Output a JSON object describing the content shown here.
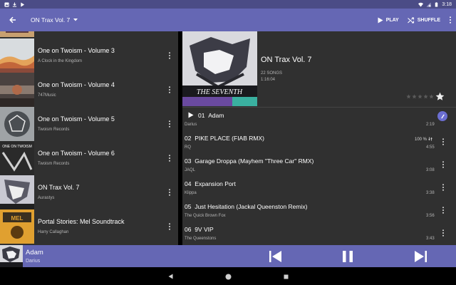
{
  "status_bar": {
    "time": "3:18"
  },
  "toolbar": {
    "title": "ON Trax Vol. 7",
    "play_label": "PLAY",
    "shuffle_label": "SHUFFLE"
  },
  "albums": [
    {
      "title": "One on Twoism - Volume 3",
      "artist": "A Clock in the Kingdom"
    },
    {
      "title": "One on Twoism - Volume 4",
      "artist": "747Music"
    },
    {
      "title": "One on Twoism - Volume 5",
      "artist": "Twoism Records"
    },
    {
      "title": "One on Twoism - Volume 6",
      "artist": "Twoism Records"
    },
    {
      "title": "ON Trax Vol. 7",
      "artist": "Aurastys"
    },
    {
      "title": "Portal Stories: Mel Soundtrack",
      "artist": "Harry Callaghan"
    }
  ],
  "album_art_text": {
    "twoism_6": "ONE ON TWOISM",
    "mel": "MEL"
  },
  "detail": {
    "title": "ON Trax Vol. 7",
    "song_count": "22 SONGS",
    "duration": "1:16:04",
    "cover_text": "THE SEVENTH",
    "rating": 0,
    "rating_max": 5
  },
  "tracks": [
    {
      "number": "01",
      "name": "Adam",
      "artist": "Darius",
      "duration": "2:19",
      "playing": true
    },
    {
      "number": "02",
      "name": "PIKE PLACE (FIAB RMX)",
      "artist": "RQ",
      "duration": "4:55",
      "download": "100 %"
    },
    {
      "number": "03",
      "name": "Garage Droppa (Mayhem \"Three Car\" RMX)",
      "artist": "JAQL",
      "duration": "3:08"
    },
    {
      "number": "04",
      "name": "Expansion Port",
      "artist": "Klippa",
      "duration": "3:38"
    },
    {
      "number": "05",
      "name": "Just Hesitation (Jackal Queenston Remix)",
      "artist": "The Quick Brown Fox",
      "duration": "3:56"
    },
    {
      "number": "06",
      "name": "9V VIP",
      "artist": "The Queenstons",
      "duration": "3:43"
    }
  ],
  "now_playing": {
    "title": "Adam",
    "artist": "Darius"
  },
  "colors": {
    "accent": "#6567b4",
    "status_bar": "#4b4c86",
    "background": "#303030",
    "indicator": "#6b6ed1"
  },
  "icons": {
    "back": "arrow-left-icon",
    "dropdown": "caret-down-icon",
    "play": "play-icon",
    "shuffle": "shuffle-icon",
    "more": "more-vertical-icon",
    "star": "star-icon",
    "previous": "skip-previous-icon",
    "pause": "pause-icon",
    "next": "skip-next-icon"
  }
}
